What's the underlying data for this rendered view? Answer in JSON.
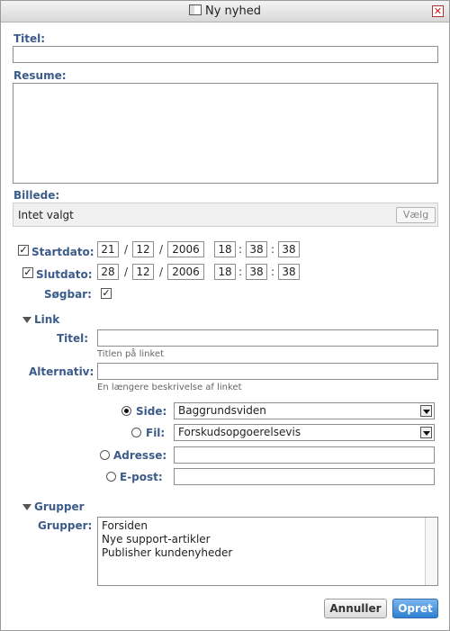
{
  "window": {
    "title": "Ny nyhed"
  },
  "labels": {
    "titel": "Titel:",
    "resume": "Resume:",
    "billede": "Billede:",
    "startdato": "Startdato:",
    "slutdato": "Slutdato:",
    "soegbar": "Søgbar:",
    "link_section": "Link",
    "link_titel": "Titel:",
    "alternativ": "Alternativ:",
    "side": "Side:",
    "fil": "Fil:",
    "adresse": "Adresse:",
    "epost": "E-post:",
    "grupper_section": "Grupper",
    "grupper": "Grupper:"
  },
  "billede": {
    "value": "Intet valgt",
    "choose_label": "Vælg"
  },
  "startdato": {
    "day": "21",
    "month": "12",
    "year": "2006",
    "hour": "18",
    "minute": "38",
    "second": "38",
    "checked": true
  },
  "slutdato": {
    "day": "28",
    "month": "12",
    "year": "2006",
    "hour": "18",
    "minute": "38",
    "second": "38",
    "checked": true
  },
  "separators": {
    "date": "/",
    "time": ":"
  },
  "soegbar": {
    "checked": true
  },
  "checkmark": "✓",
  "link": {
    "titel_hint": "Titlen på linket",
    "alternativ_hint": "En længere beskrivelse af linket",
    "side_value": "Baggrundsviden",
    "fil_value": "Forskudsopgoerelsevis",
    "selected": "side"
  },
  "grupper": {
    "items": [
      "Forsiden",
      "Nye support-artikler",
      "Publisher kundenyheder"
    ]
  },
  "buttons": {
    "cancel": "Annuller",
    "create": "Opret"
  },
  "close_glyph": "✕"
}
